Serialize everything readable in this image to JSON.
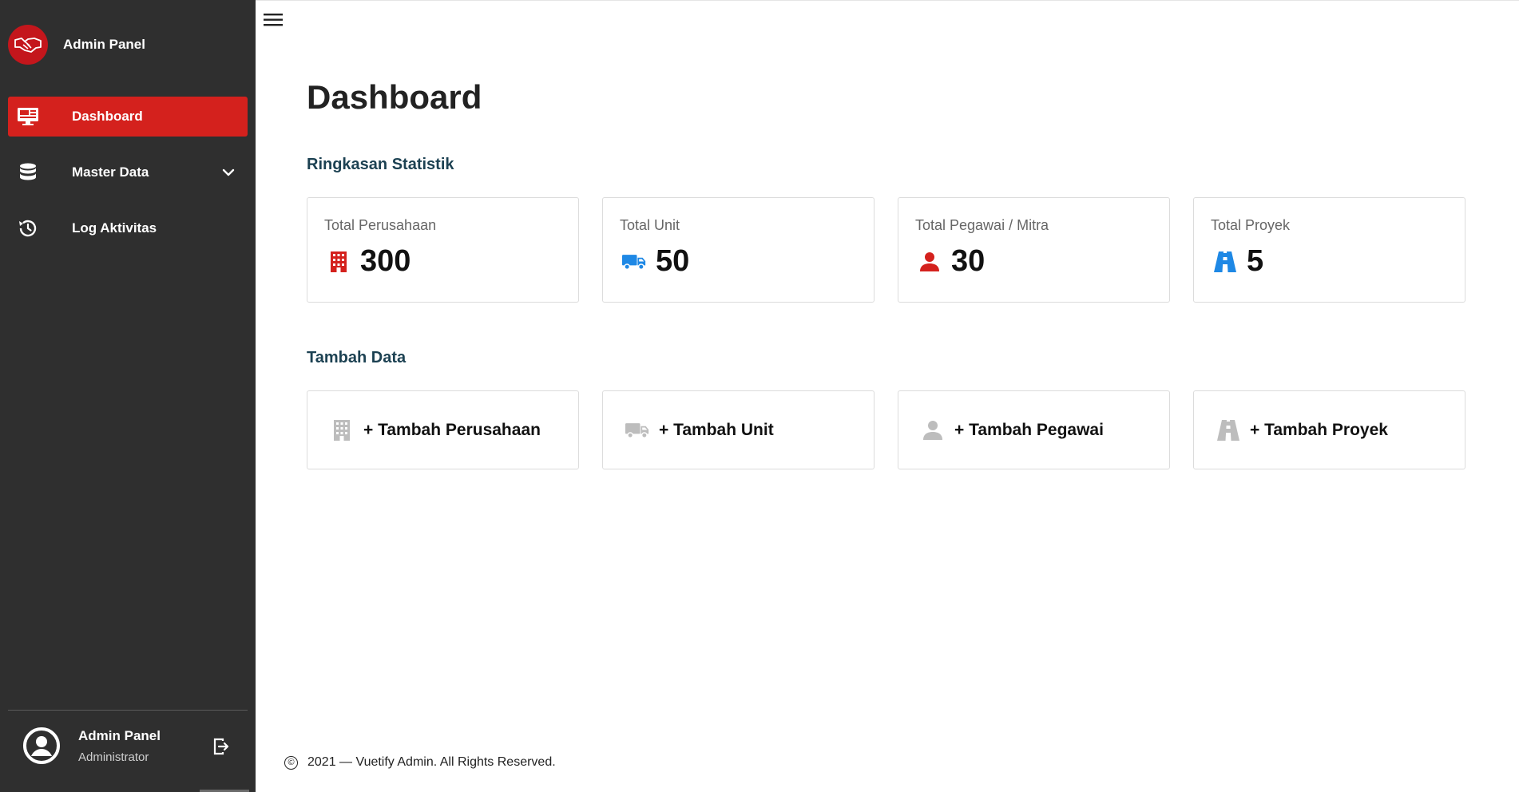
{
  "sidebar": {
    "brand_title": "Admin Panel",
    "items": [
      {
        "label": "Dashboard",
        "icon": "monitor-icon",
        "active": true
      },
      {
        "label": "Master Data",
        "icon": "database-icon",
        "has_dropdown": true
      },
      {
        "label": "Log Aktivitas",
        "icon": "history-icon"
      }
    ],
    "user": {
      "name": "Admin Panel",
      "role": "Administrator"
    }
  },
  "main": {
    "page_title": "Dashboard",
    "stats_title": "Ringkasan Statistik",
    "stats": [
      {
        "label": "Total Perusahaan",
        "value": "300",
        "icon": "building-icon",
        "color": "#d4211d"
      },
      {
        "label": "Total Unit",
        "value": "50",
        "icon": "truck-icon",
        "color": "#1e88e5"
      },
      {
        "label": "Total Pegawai / Mitra",
        "value": "30",
        "icon": "person-icon",
        "color": "#d4211d"
      },
      {
        "label": "Total Proyek",
        "value": "5",
        "icon": "road-icon",
        "color": "#1e88e5"
      }
    ],
    "add_title": "Tambah Data",
    "add_actions": [
      {
        "label": "+ Tambah Perusahaan",
        "icon": "building-icon"
      },
      {
        "label": "+ Tambah Unit",
        "icon": "truck-icon"
      },
      {
        "label": "+ Tambah Pegawai",
        "icon": "person-icon"
      },
      {
        "label": "+ Tambah Proyek",
        "icon": "road-icon"
      }
    ]
  },
  "footer": {
    "copyright_symbol": "©",
    "text": "2021 — Vuetify Admin. All Rights Reserved."
  },
  "colors": {
    "sidebar_bg": "#2f2f2f",
    "accent_red": "#d4211d",
    "accent_blue": "#1e88e5",
    "section_title": "#1c4152",
    "muted_icon": "#bdbdbd"
  }
}
